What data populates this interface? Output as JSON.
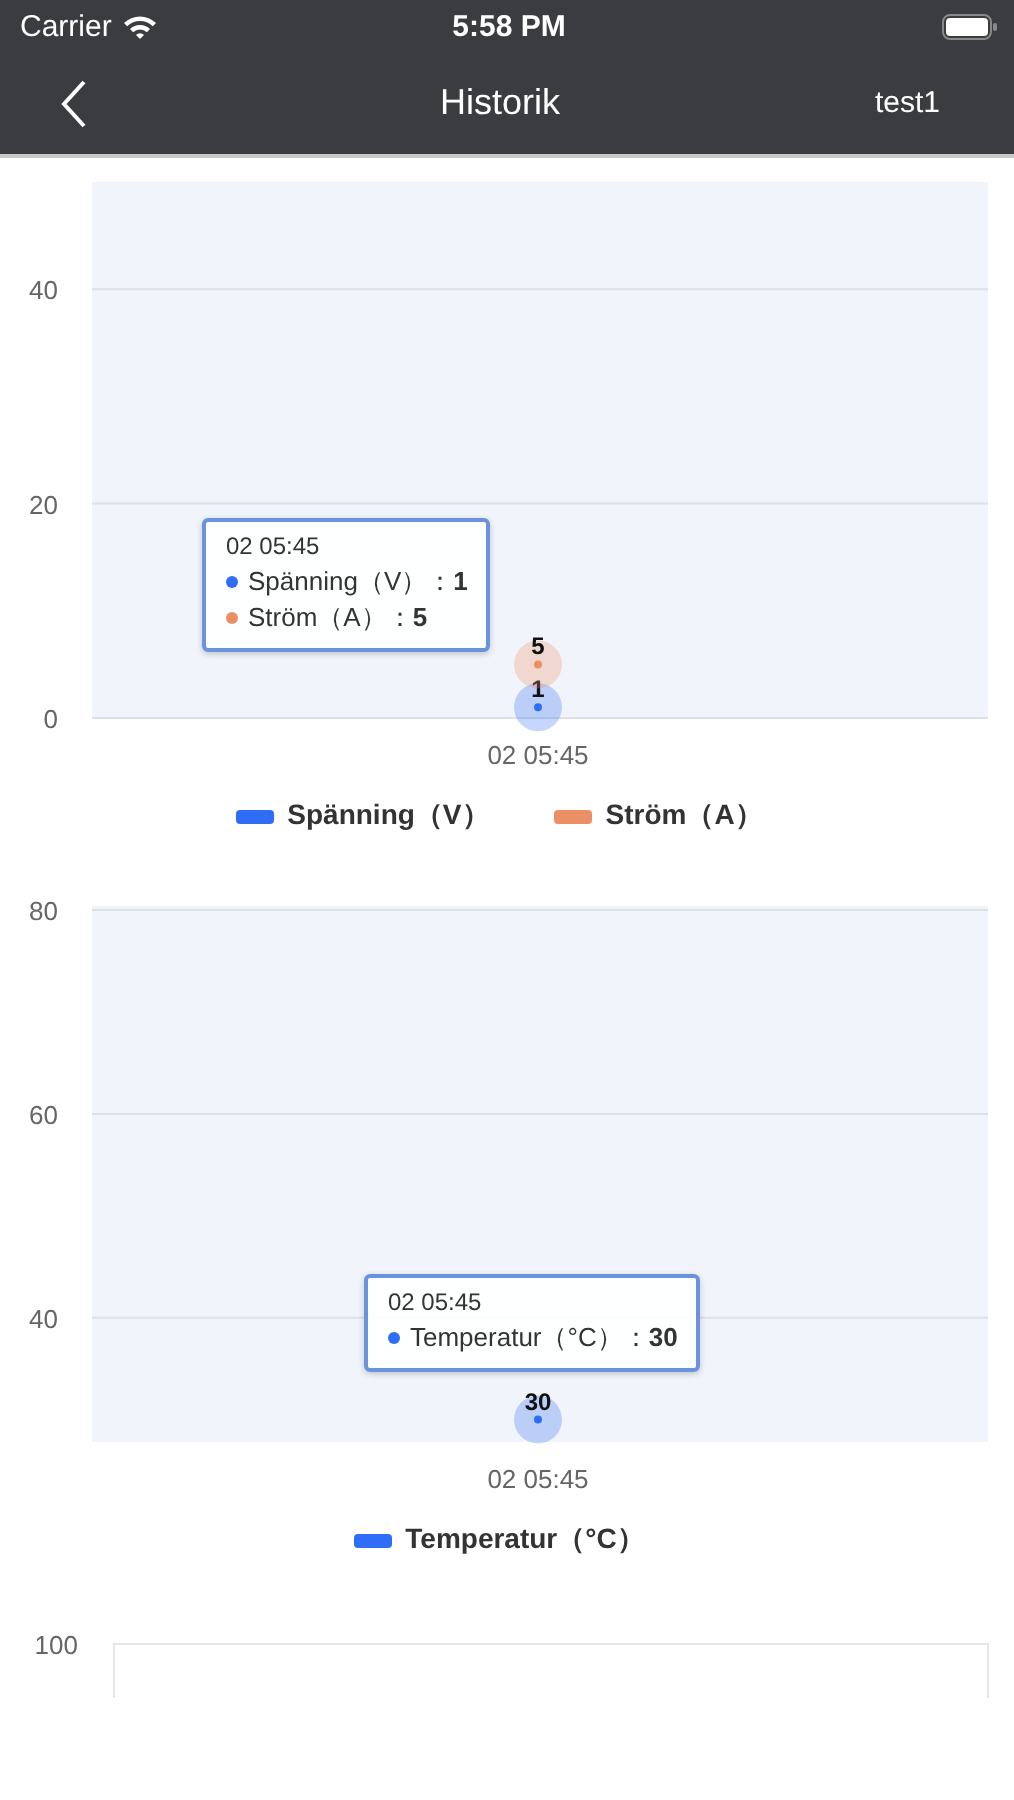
{
  "status_bar": {
    "carrier": "Carrier",
    "time": "5:58 PM"
  },
  "nav": {
    "title": "Historik",
    "right": "test1"
  },
  "charts": [
    {
      "chart_data": {
        "type": "line",
        "categories": [
          "02 05:45"
        ],
        "series": [
          {
            "name": "Spänning（V）",
            "color": "#2f6df6",
            "marker": "circle",
            "values": [
              1
            ]
          },
          {
            "name": "Ström（A）",
            "color": "#ec8f67",
            "marker": "circle",
            "values": [
              5
            ]
          }
        ],
        "ylim": [
          0,
          50
        ],
        "yticks": [
          0,
          20,
          40
        ],
        "data_labels": true,
        "legend": "bottom"
      },
      "tooltip": {
        "title": "02 05:45",
        "rows": [
          {
            "text": "Spänning（V）：**1**",
            "color": "#2f6df6"
          },
          {
            "text": "Ström（A）：**5**",
            "color": "#ec8f67"
          }
        ]
      }
    },
    {
      "chart_data": {
        "type": "line",
        "categories": [
          "02 05:45"
        ],
        "series": [
          {
            "name": "Temperatur（°C）",
            "color": "#2f6df6",
            "marker": "circle",
            "values": [
              30
            ]
          }
        ],
        "ylim": [
          27.8,
          80.4
        ],
        "yticks": [
          40,
          60,
          80
        ],
        "data_labels": true,
        "legend": "bottom"
      },
      "tooltip": {
        "title": "02 05:45",
        "rows": [
          {
            "text": "Temperatur（°C）：**30**",
            "color": "#2f6df6"
          }
        ]
      }
    },
    {
      "partial_axis_label": "100"
    }
  ]
}
